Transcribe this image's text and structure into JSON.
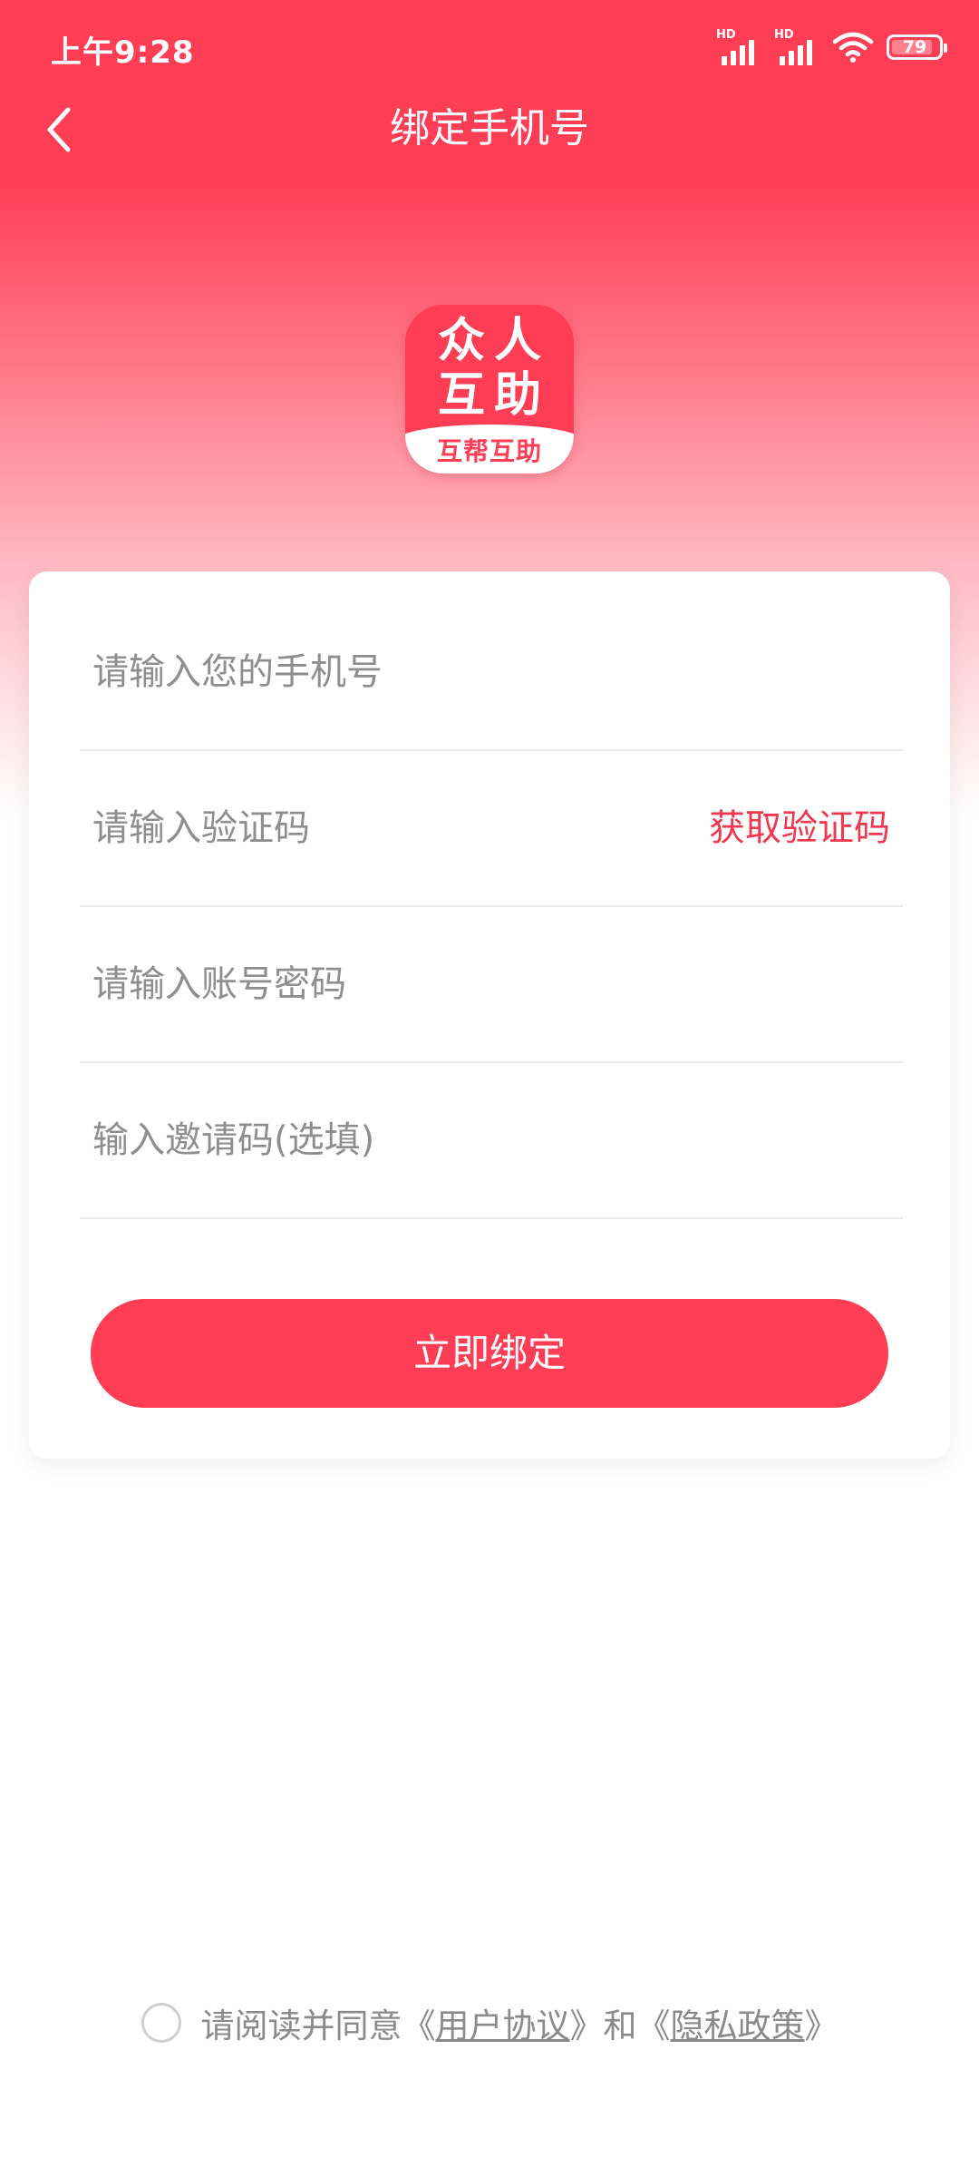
{
  "status_bar": {
    "time": "上午9:28",
    "signal_1_label": "HD",
    "signal_2_label": "HD",
    "battery_level": "79",
    "icons": [
      "signal-icon",
      "signal-icon",
      "wifi-icon",
      "battery-icon"
    ]
  },
  "header": {
    "title": "绑定手机号",
    "back_icon": "chevron-left-icon"
  },
  "logo": {
    "line1": "众人",
    "line2": "互助",
    "band_text": "互帮互助",
    "brand_color": "#ff3e55"
  },
  "form": {
    "phone_placeholder": "请输入您的手机号",
    "code_placeholder": "请输入验证码",
    "get_code_label": "获取验证码",
    "password_placeholder": "请输入账号密码",
    "invite_placeholder": "输入邀请码(选填)",
    "submit_label": "立即绑定"
  },
  "agreement": {
    "prefix": "请阅读并同意",
    "open_bracket_1": "《",
    "user_agreement": "用户协议",
    "close_bracket_1": "》",
    "conjunction": "和",
    "open_bracket_2": "《",
    "privacy_policy": "隐私政策",
    "close_bracket_2": "》"
  },
  "colors": {
    "accent": "#ff3e55",
    "link_accent": "#f1384f",
    "placeholder": "#8e8e8e",
    "divider": "#ececec"
  }
}
